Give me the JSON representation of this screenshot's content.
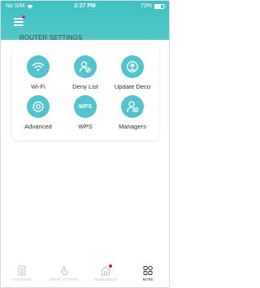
{
  "status_bar": {
    "carrier": "No SIM",
    "time": "2:37 PM",
    "battery_text": "73%",
    "battery_level": 0.73
  },
  "header": {
    "menu_icon": "hamburger-menu-icon",
    "notification_color": "#9b3ab8",
    "gradient_colors": [
      "#3ec1c4",
      "#54c8c7"
    ]
  },
  "section": {
    "title": "ROUTER SETTINGS"
  },
  "tiles": [
    {
      "label": "Wi-Fi",
      "icon": "wifi-icon"
    },
    {
      "label": "Deny List",
      "icon": "deny-list-icon"
    },
    {
      "label": "Update Deco",
      "icon": "update-icon"
    },
    {
      "label": "Advanced",
      "icon": "gear-icon"
    },
    {
      "label": "WPS",
      "icon": "wps-icon",
      "icon_text": "WPS"
    },
    {
      "label": "Managers",
      "icon": "managers-icon"
    }
  ],
  "accent_color": "#55c3cd",
  "bottom_nav": {
    "items": [
      {
        "label": "OVERVIEW",
        "icon": "overview-icon",
        "active": false
      },
      {
        "label": "SMART ACTIONS",
        "icon": "smart-actions-icon",
        "active": false
      },
      {
        "label": "HOMESHIELD",
        "icon": "homeshield-icon",
        "active": false,
        "badge": true
      },
      {
        "label": "MORE",
        "icon": "more-icon",
        "active": true
      }
    ]
  }
}
